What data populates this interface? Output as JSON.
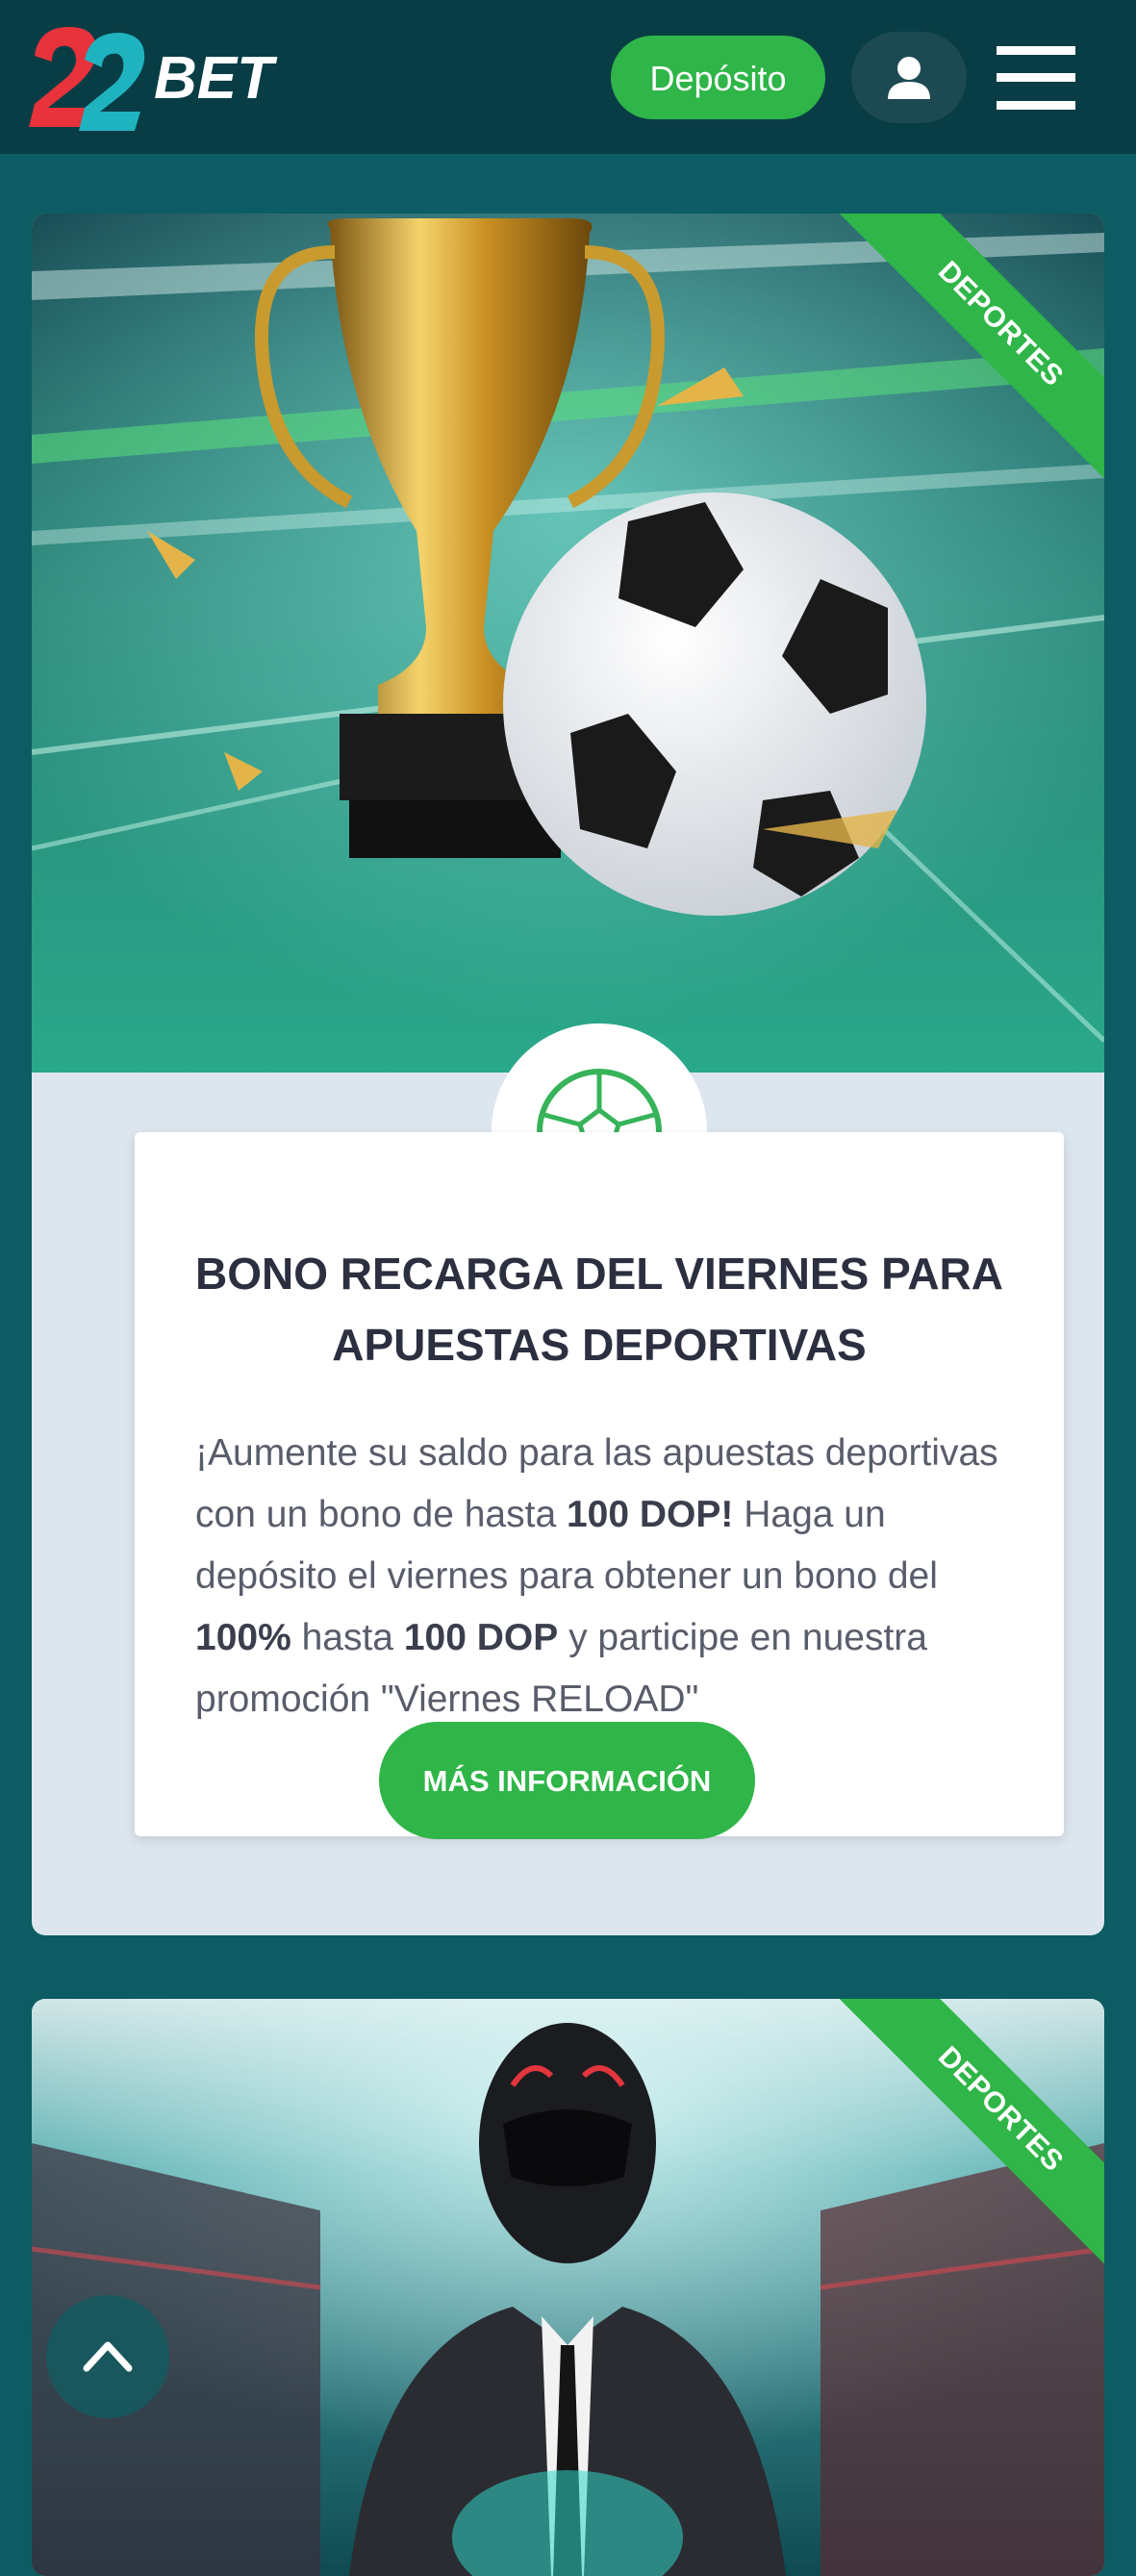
{
  "header": {
    "logo_text": "22BET",
    "deposit_label": "Depósito"
  },
  "promos": [
    {
      "category": "DEPORTES",
      "title": "BONO RECARGA DEL VIERNES PARA APUESTAS DEPORTIVAS",
      "desc_1": "¡Aumente su saldo para las apuestas deportivas con un bono de hasta ",
      "desc_b1": "100 DOP!",
      "desc_2": " Haga un depósito el viernes para obtener un bono del ",
      "desc_b2": "100%",
      "desc_3": " hasta ",
      "desc_b3": "100 DOP",
      "desc_4": " y participe en nuestra promoción \"Viernes RELOAD\"",
      "button_label": "MÁS INFORMACIÓN"
    },
    {
      "category": "DEPORTES"
    }
  ],
  "colors": {
    "brand_green": "#2fb548",
    "header_bg": "#083d45",
    "page_bg": "#0d5c63",
    "card_bg": "#dde6ee"
  },
  "icons": [
    "user-icon",
    "menu-icon",
    "soccer-ball-icon",
    "chevron-up-icon"
  ]
}
